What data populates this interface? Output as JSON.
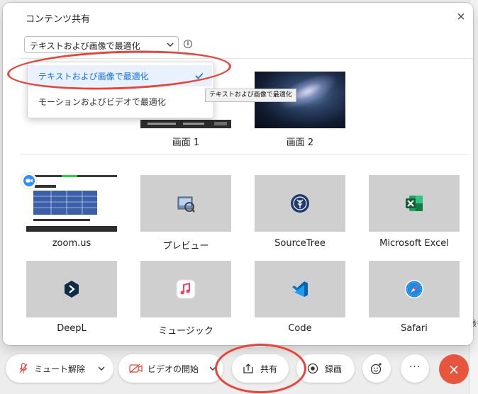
{
  "dialog": {
    "title": "コンテンツ共有",
    "close_glyph": "×",
    "dropdown_value": "テキストおよび画像で最適化",
    "menu": {
      "items": [
        {
          "label": "テキストおよび画像で最適化",
          "selected": true
        },
        {
          "label": "モーションおよびビデオで最適化",
          "selected": false
        }
      ]
    },
    "tooltip": "テキストおよび画像で最適化",
    "screens": [
      {
        "label": "画面 1"
      },
      {
        "label": "画面 2"
      }
    ],
    "apps": [
      {
        "label": "zoom.us",
        "icon": "zoom-window-thumbnail"
      },
      {
        "label": "プレビュー",
        "icon": "preview-icon"
      },
      {
        "label": "SourceTree",
        "icon": "sourcetree-icon"
      },
      {
        "label": "Microsoft Excel",
        "icon": "excel-icon"
      },
      {
        "label": "DeepL",
        "icon": "deepl-icon"
      },
      {
        "label": "ミュージック",
        "icon": "music-icon"
      },
      {
        "label": "Code",
        "icon": "vscode-icon"
      },
      {
        "label": "Safari",
        "icon": "safari-icon"
      }
    ]
  },
  "toolbar": {
    "unmute_label": "ミュート解除",
    "video_label": "ビデオの開始",
    "share_label": "共有",
    "record_label": "録画",
    "more_glyph": "···",
    "end_glyph": "×"
  },
  "background": {
    "edge_text": "最を"
  },
  "colors": {
    "accent": "#0e71eb",
    "annotation_red": "#e9443a",
    "end_button": "#e8553d",
    "tile_bg": "#cfcfcf"
  }
}
